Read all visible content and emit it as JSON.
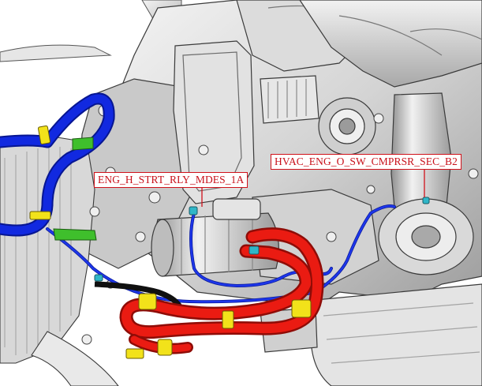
{
  "callouts": {
    "starter_relay": "ENG_H_STRT_RLY_MDES_1A",
    "hvac_compressor_switch": "HVAC_ENG_O_SW_CMPRSR_SEC_B2"
  },
  "colors": {
    "harness_blue": "#0a1fd6",
    "hose_red": "#ea1b12",
    "clip_yellow": "#f2e21a",
    "bracket_green": "#3fbf2c",
    "connector_cyan": "#2fb6c8",
    "engine_grey": "#d6d6d6",
    "callout_red": "#d0121b"
  }
}
